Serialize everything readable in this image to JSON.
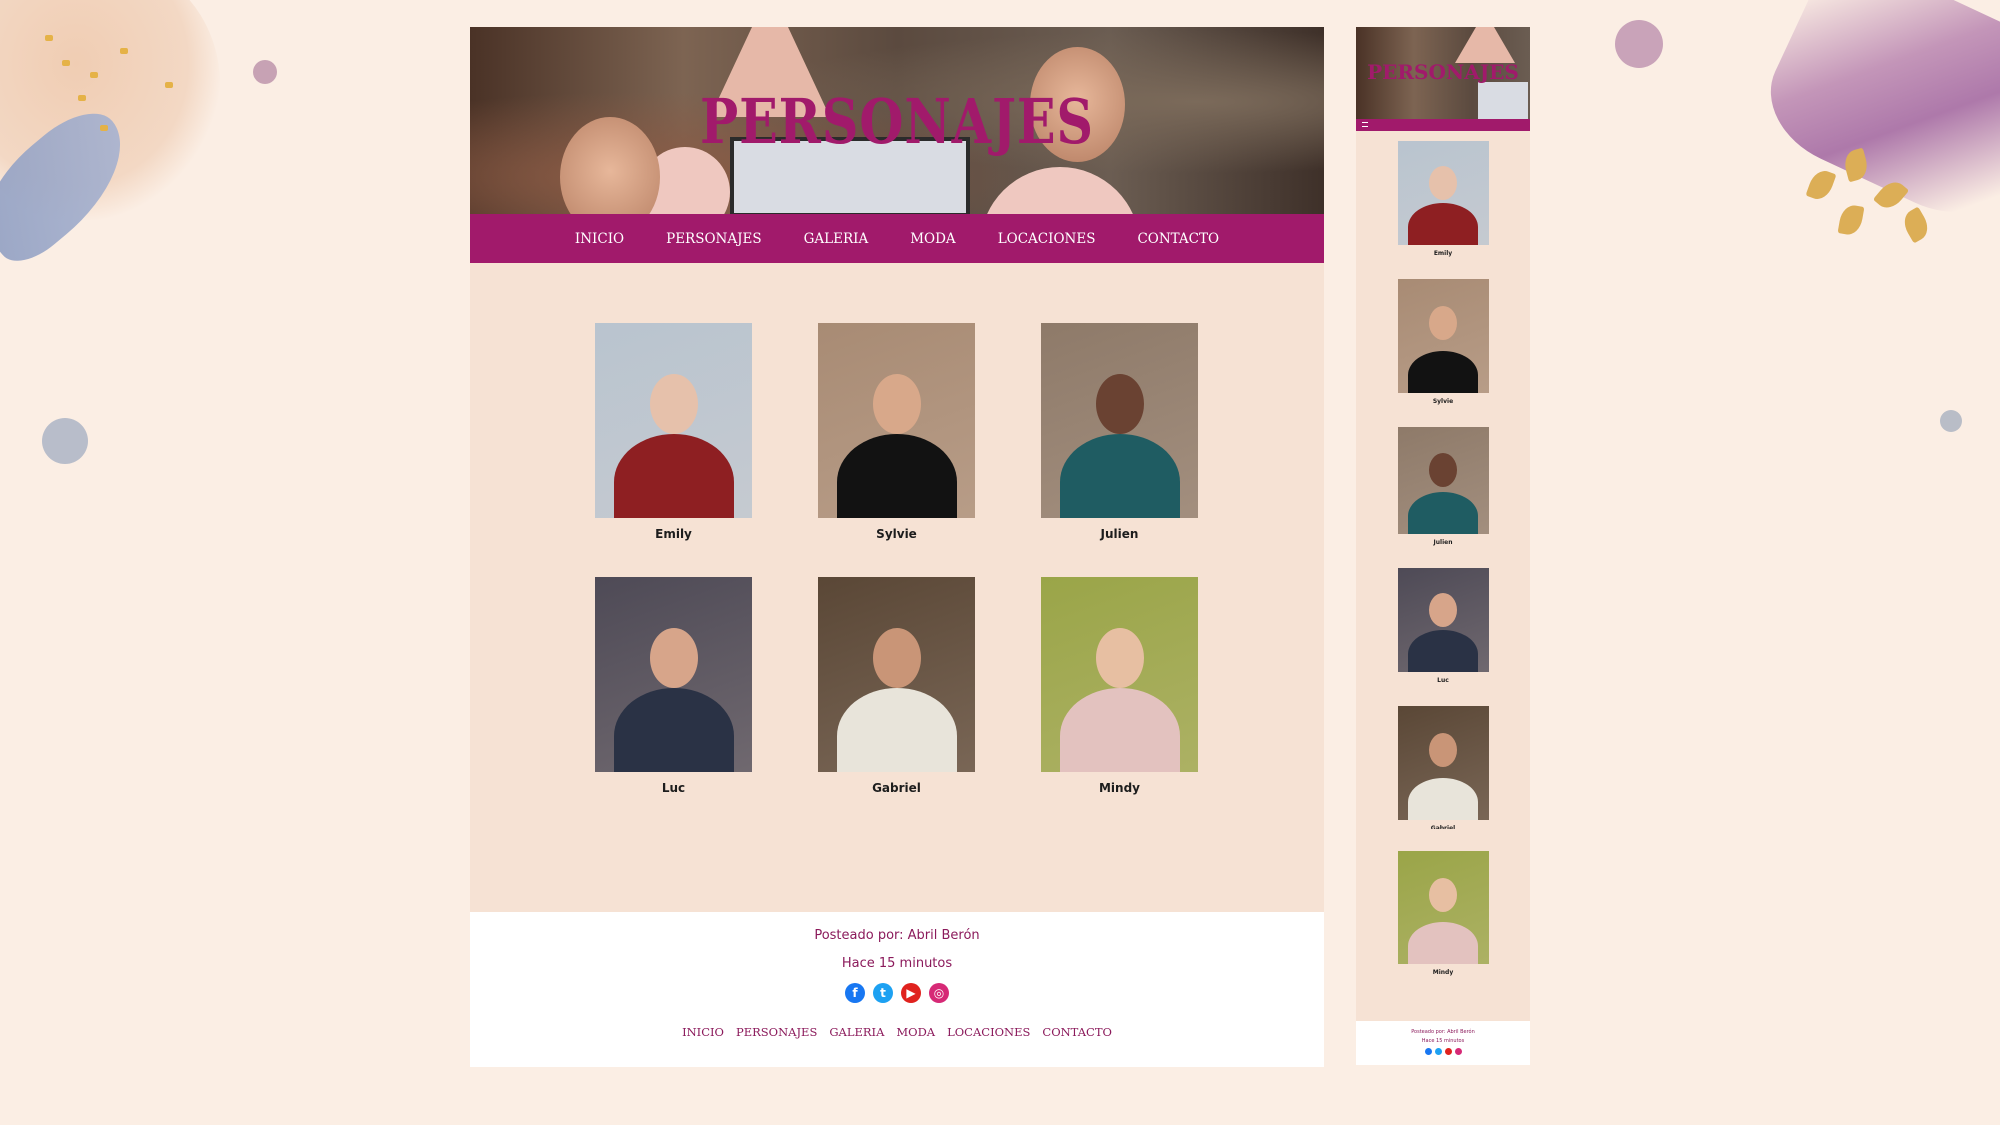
{
  "site": {
    "hero_title": "PERSONAJES",
    "accent_color": "#a11a6b",
    "nav": [
      {
        "label": "INICIO"
      },
      {
        "label": "PERSONAJES"
      },
      {
        "label": "GALERIA"
      },
      {
        "label": "MODA"
      },
      {
        "label": "LOCACIONES"
      },
      {
        "label": "CONTACTO"
      }
    ]
  },
  "characters": [
    {
      "name": "Emily",
      "palette": {
        "bg": "#b9c4cf",
        "skin": "#e6c1ab",
        "outfit": "#8e1f22"
      }
    },
    {
      "name": "Sylvie",
      "palette": {
        "bg": "#a88b74",
        "skin": "#d8a88a",
        "outfit": "#121212"
      }
    },
    {
      "name": "Julien",
      "palette": {
        "bg": "#8e7a69",
        "skin": "#6a4232",
        "outfit": "#1f5c62"
      }
    },
    {
      "name": "Luc",
      "palette": {
        "bg": "#4e4a56",
        "skin": "#d7a58a",
        "outfit": "#2a3245"
      }
    },
    {
      "name": "Gabriel",
      "palette": {
        "bg": "#5a4736",
        "skin": "#c99577",
        "outfit": "#e8e4da"
      }
    },
    {
      "name": "Mindy",
      "palette": {
        "bg": "#9aa548",
        "skin": "#e7bfa2",
        "outfit": "#e3c2bf"
      }
    }
  ],
  "footer": {
    "posted_by": "Posteado por: Abril Berón",
    "time_ago": "Hace 15 minutos",
    "social": [
      {
        "icon": "facebook-icon",
        "glyph": "f",
        "color": "#1877f2"
      },
      {
        "icon": "twitter-icon",
        "glyph": "t",
        "color": "#1da1f2"
      },
      {
        "icon": "youtube-icon",
        "glyph": "▶",
        "color": "#e0221e"
      },
      {
        "icon": "instagram-icon",
        "glyph": "◎",
        "color": "#d62976"
      }
    ],
    "nav": [
      {
        "label": "INICIO"
      },
      {
        "label": "PERSONAJES"
      },
      {
        "label": "GALERIA"
      },
      {
        "label": "MODA"
      },
      {
        "label": "LOCACIONES"
      },
      {
        "label": "CONTACTO"
      }
    ]
  },
  "mobile": {
    "hero_title": "PERSONAJES",
    "posted_by": "Posteado por: Abril Berón",
    "time_ago": "Hace 15 minutos"
  }
}
